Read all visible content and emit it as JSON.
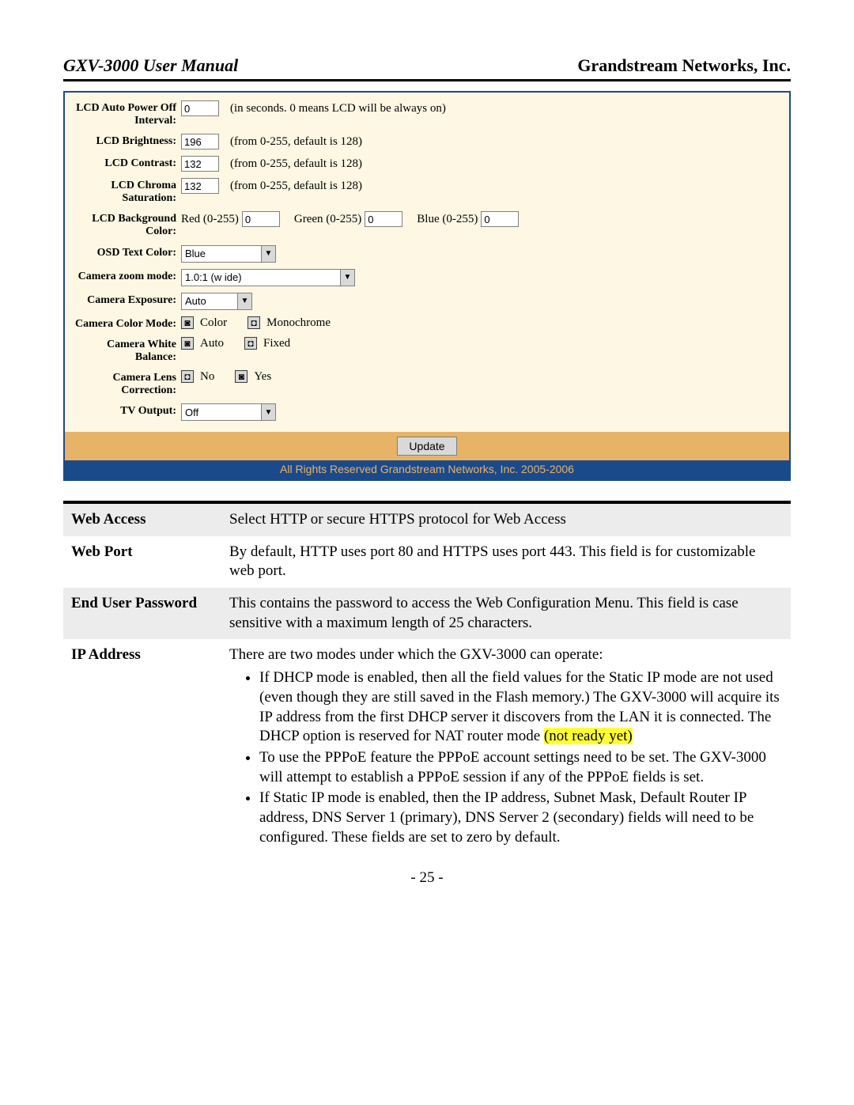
{
  "header": {
    "left": "GXV-3000 User Manual",
    "right": "Grandstream Networks, Inc."
  },
  "cfg": {
    "lcd_auto_power": {
      "label": "LCD Auto Power Off Interval:",
      "value": "0",
      "hint": "(in seconds. 0 means LCD will be always on)"
    },
    "lcd_brightness": {
      "label": "LCD Brightness:",
      "value": "196",
      "hint": "(from 0-255, default is 128)"
    },
    "lcd_contrast": {
      "label": "LCD Contrast:",
      "value": "132",
      "hint": "(from 0-255, default is 128)"
    },
    "lcd_chroma": {
      "label": "LCD Chroma Saturation:",
      "value": "132",
      "hint": "(from 0-255, default is 128)"
    },
    "lcd_bg": {
      "label": "LCD Background Color:",
      "red_label": "Red (0-255)",
      "red_value": "0",
      "green_label": "Green (0-255)",
      "green_value": "0",
      "blue_label": "Blue (0-255)",
      "blue_value": "0"
    },
    "osd_text_color": {
      "label": "OSD Text Color:",
      "value": "Blue"
    },
    "camera_zoom": {
      "label": "Camera zoom mode:",
      "value": "1.0:1 (w ide)"
    },
    "camera_exposure": {
      "label": "Camera Exposure:",
      "value": "Auto"
    },
    "camera_color_mode": {
      "label": "Camera Color Mode:",
      "opt1": "Color",
      "opt2": "Monochrome"
    },
    "camera_wb": {
      "label": "Camera White Balance:",
      "opt1": "Auto",
      "opt2": "Fixed"
    },
    "camera_lens": {
      "label": "Camera Lens Correction:",
      "opt1": "No",
      "opt2": "Yes"
    },
    "tv_output": {
      "label": "TV Output:",
      "value": "Off"
    },
    "update_btn": "Update",
    "copyright": "All Rights Reserved Grandstream Networks, Inc. 2005-2006"
  },
  "desc": {
    "web_access": {
      "term": "Web Access",
      "text": "Select HTTP or secure HTTPS protocol for Web Access"
    },
    "web_port": {
      "term": "Web Port",
      "text": "By default, HTTP uses port 80 and HTTPS uses port 443. This field is for customizable web port."
    },
    "end_user": {
      "term": "End User Password",
      "text": "This contains the password to access the Web Configuration Menu. This field is case sensitive with a maximum length of 25 characters."
    },
    "ip_address": {
      "term": "IP Address",
      "intro": "There are two modes under which the GXV-3000 can operate:",
      "b1a": "If DHCP mode is enabled, then all the field values for the Static IP mode are not used (even though they are still saved in the Flash memory.) The GXV-3000 will acquire its IP address from the first DHCP server it discovers from the LAN it is connected. The DHCP option is reserved for NAT router mode ",
      "b1hl": "(not ready yet)",
      "b2": "To use the PPPoE feature the PPPoE account settings need to be set. The GXV-3000 will attempt to establish a PPPoE session if any of the PPPoE fields is set.",
      "b3": "If Static IP mode is enabled, then the IP address, Subnet Mask, Default Router IP address, DNS Server 1 (primary), DNS Server 2 (secondary) fields will need to be configured. These fields are set to zero by default."
    }
  },
  "page_number": "- 25 -"
}
